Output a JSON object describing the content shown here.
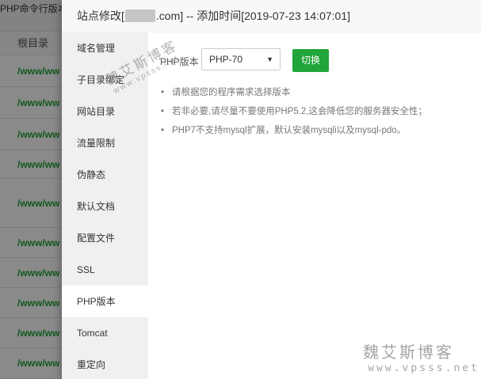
{
  "background": {
    "topbar_text": "PHP命令行版本",
    "column_header": "根目录",
    "row_text": "/www/ww"
  },
  "modal": {
    "title_prefix": "站点修改[",
    "title_suffix": ".com] -- 添加时间[2019-07-23 14:07:01]"
  },
  "menu": {
    "items": [
      {
        "label": "域名管理"
      },
      {
        "label": "子目录绑定"
      },
      {
        "label": "网站目录"
      },
      {
        "label": "流量限制"
      },
      {
        "label": "伪静态"
      },
      {
        "label": "默认文档"
      },
      {
        "label": "配置文件"
      },
      {
        "label": "SSL"
      },
      {
        "label": "PHP版本"
      },
      {
        "label": "Tomcat"
      },
      {
        "label": "重定向"
      }
    ],
    "active_index": 8
  },
  "php": {
    "label": "PHP版本",
    "selected": "PHP-70",
    "switch_button": "切换"
  },
  "tips": [
    "请根据您的程序需求选择版本",
    "若非必要,请尽量不要使用PHP5.2,这会降低您的服务器安全性；",
    "PHP7不支持mysql扩展，默认安装mysqli以及mysql-pdo。"
  ],
  "watermark": {
    "cn": "魏艾斯博客",
    "en": "www.vpsss.net"
  },
  "colors": {
    "accent": "#20a53a",
    "menu_bg": "#f0f0f0"
  }
}
